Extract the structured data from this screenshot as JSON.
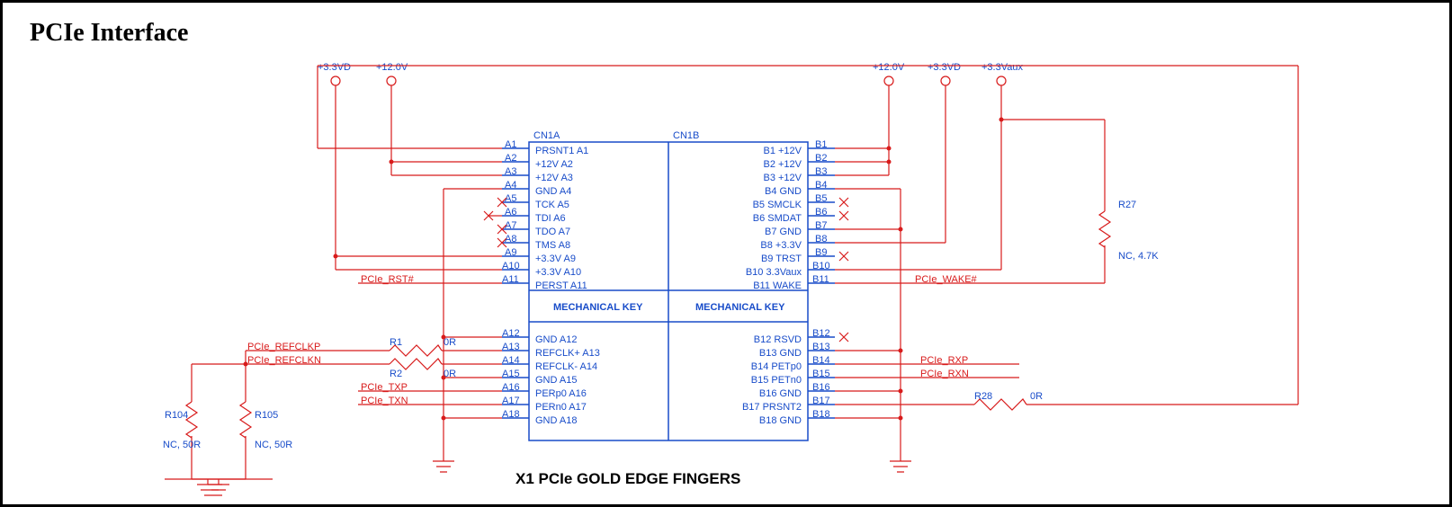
{
  "title": "PCIe Interface",
  "footer": "X1 PCIe GOLD EDGE FINGERS",
  "rails": {
    "v33d": "+3.3VD",
    "v12": "+12.0V",
    "v12r": "+12.0V",
    "v33dr": "+3.3VD",
    "v33aux": "+3.3Vaux"
  },
  "cn_a": "CN1A",
  "cn_b": "CN1B",
  "mech": "MECHANICAL KEY",
  "left_pins_top": [
    "A1",
    "A2",
    "A3",
    "A4",
    "A5",
    "A6",
    "A7",
    "A8",
    "A9",
    "A10",
    "A11"
  ],
  "left_pins_bot": [
    "A12",
    "A13",
    "A14",
    "A15",
    "A16",
    "A17",
    "A18"
  ],
  "right_pins_top": [
    "B1",
    "B2",
    "B3",
    "B4",
    "B5",
    "B6",
    "B7",
    "B8",
    "B9",
    "B10",
    "B11"
  ],
  "right_pins_bot": [
    "B12",
    "B13",
    "B14",
    "B15",
    "B16",
    "B17",
    "B18"
  ],
  "labels_a_top": [
    "PRSNT1 A1",
    "+12V  A2",
    "+12V  A3",
    "GND A4",
    "TCK  A5",
    "TDI A6",
    "TDO  A7",
    "TMS  A8",
    "+3.3V  A9",
    "+3.3V A10",
    "PERST A11"
  ],
  "labels_b_top": [
    "B1  +12V",
    "B2  +12V",
    "B3  +12V",
    "B4 GND",
    "B5 SMCLK",
    "B6  SMDAT",
    "B7 GND",
    "B8  +3.3V",
    "B9  TRST",
    "B10 3.3Vaux",
    "B11 WAKE"
  ],
  "labels_a_bot": [
    "GND A12",
    "REFCLK+ A13",
    "REFCLK- A14",
    "GND A15",
    "PERp0 A16",
    "PERn0 A17",
    "GND A18"
  ],
  "labels_b_bot": [
    "B12 RSVD",
    "B13 GND",
    "B14 PETp0",
    "B15 PETn0",
    "B16 GND",
    "B17 PRSNT2",
    "B18 GND"
  ],
  "nets": {
    "rst": "PCIe_RST#",
    "wake": "PCIe_WAKE#",
    "refclkp": "PCIe_REFCLKP",
    "refclkn": "PCIe_REFCLKN",
    "txp": "PCIe_TXP",
    "txn": "PCIe_TXN",
    "rxp": "PCIe_RXP",
    "rxn": "PCIe_RXN"
  },
  "parts": {
    "r1": "R1",
    "r1v": "0R",
    "r2": "R2",
    "r2v": "0R",
    "r27": "R27",
    "r27v": "NC, 4.7K",
    "r28": "R28",
    "r28v": "0R",
    "r104": "R104",
    "r104v": "NC, 50R",
    "r105": "R105",
    "r105v": "NC, 50R"
  }
}
